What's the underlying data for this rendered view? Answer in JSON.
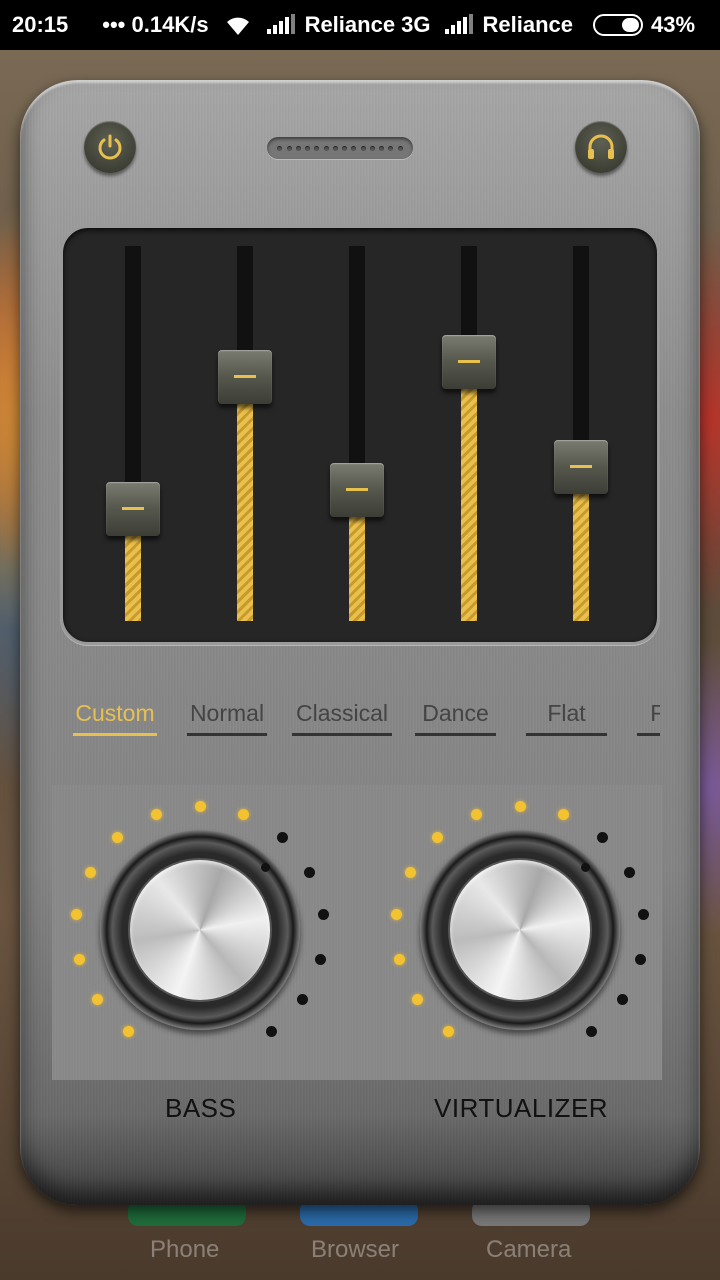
{
  "status_bar": {
    "time": "20:15",
    "net_speed": "0.14K/s",
    "carrier1": "Reliance 3G",
    "carrier2": "Reliance",
    "battery": "43%",
    "battery_level": 0.43
  },
  "colors": {
    "accent": "#e8c050",
    "panel": "#8e8e8e",
    "screen": "#262626"
  },
  "top_controls": {
    "power_icon": "power-icon",
    "headphones_icon": "headphones-icon"
  },
  "equalizer": {
    "band_levels": [
      0.3,
      0.65,
      0.35,
      0.69,
      0.41
    ]
  },
  "presets": {
    "items": [
      "Custom",
      "Normal",
      "Classical",
      "Dance",
      "Flat",
      "Folk"
    ],
    "selected": "Custom"
  },
  "dials": {
    "bass": {
      "label": "BASS",
      "level": 0.62
    },
    "virtualizer": {
      "label": "VIRTUALIZER",
      "level": 0.62
    }
  },
  "dock": {
    "items": [
      "Phone",
      "Browser",
      "Camera"
    ]
  }
}
